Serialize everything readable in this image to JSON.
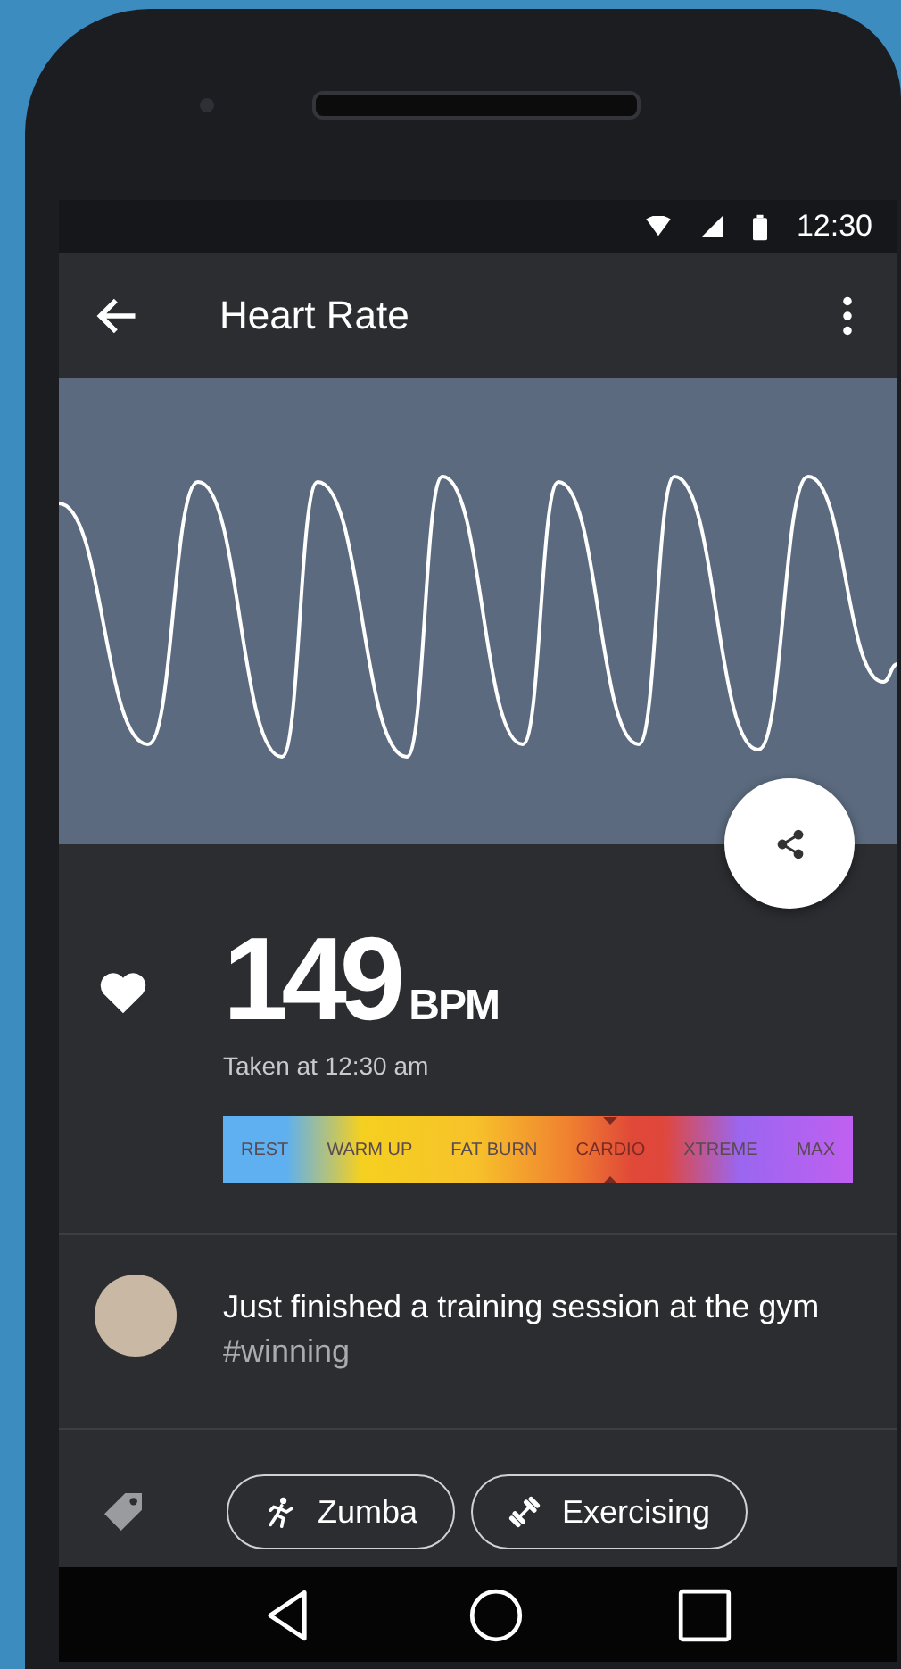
{
  "status_bar": {
    "time": "12:30"
  },
  "app_bar": {
    "title": "Heart Rate"
  },
  "reading": {
    "value": "149",
    "unit": "BPM",
    "taken": "Taken at 12:30 am"
  },
  "zones": [
    {
      "label": "REST",
      "selected": false
    },
    {
      "label": "WARM UP",
      "selected": false
    },
    {
      "label": "FAT BURN",
      "selected": false
    },
    {
      "label": "CARDIO",
      "selected": true
    },
    {
      "label": "XTREME",
      "selected": false
    },
    {
      "label": "MAX",
      "selected": false
    }
  ],
  "post": {
    "text": "Just finished a training session at the gym",
    "hashtag": "#winning"
  },
  "tags": [
    {
      "kind": "dance",
      "label": "Zumba"
    },
    {
      "kind": "dumbbell",
      "label": "Exercising"
    }
  ]
}
